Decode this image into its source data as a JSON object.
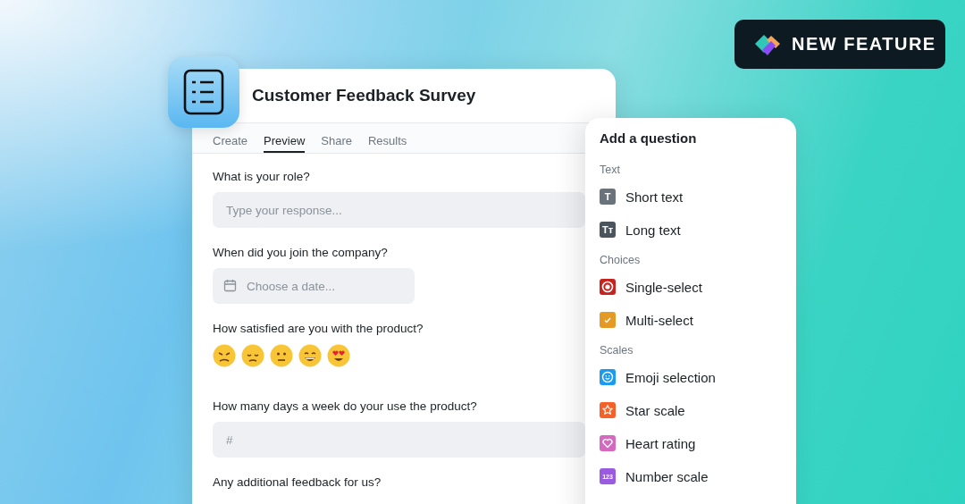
{
  "badge": {
    "label": "NEW FEATURE"
  },
  "survey": {
    "title": "Customer Feedback Survey",
    "tabs": [
      {
        "label": "Create",
        "selected": false
      },
      {
        "label": "Preview",
        "selected": true
      },
      {
        "label": "Share",
        "selected": false
      },
      {
        "label": "Results",
        "selected": false
      }
    ],
    "questions": [
      {
        "kind": "text",
        "label": "What is your role?",
        "placeholder": "Type your response..."
      },
      {
        "kind": "date",
        "label": "When did you join the company?",
        "placeholder": "Choose a date..."
      },
      {
        "kind": "emoji",
        "label": "How satisfied are you with the product?"
      },
      {
        "kind": "number",
        "label": "How many days a week do your use the product?",
        "placeholder": "#"
      },
      {
        "kind": "long",
        "label": "Any additional feedback for us?"
      }
    ]
  },
  "add_panel": {
    "title": "Add a question",
    "sections": [
      {
        "title": "Text",
        "items": [
          {
            "kind": "short_text",
            "label": "Short text",
            "icon_text": "T"
          },
          {
            "kind": "long_text",
            "label": "Long text",
            "icon_text": "Tᴛ"
          }
        ]
      },
      {
        "title": "Choices",
        "items": [
          {
            "kind": "single_select",
            "label": "Single-select"
          },
          {
            "kind": "multi_select",
            "label": "Multi-select"
          }
        ]
      },
      {
        "title": "Scales",
        "items": [
          {
            "kind": "emoji",
            "label": "Emoji selection"
          },
          {
            "kind": "star",
            "label": "Star scale"
          },
          {
            "kind": "heart",
            "label": "Heart rating"
          },
          {
            "kind": "number",
            "label": "Number scale",
            "icon_text": "123"
          }
        ]
      }
    ]
  }
}
